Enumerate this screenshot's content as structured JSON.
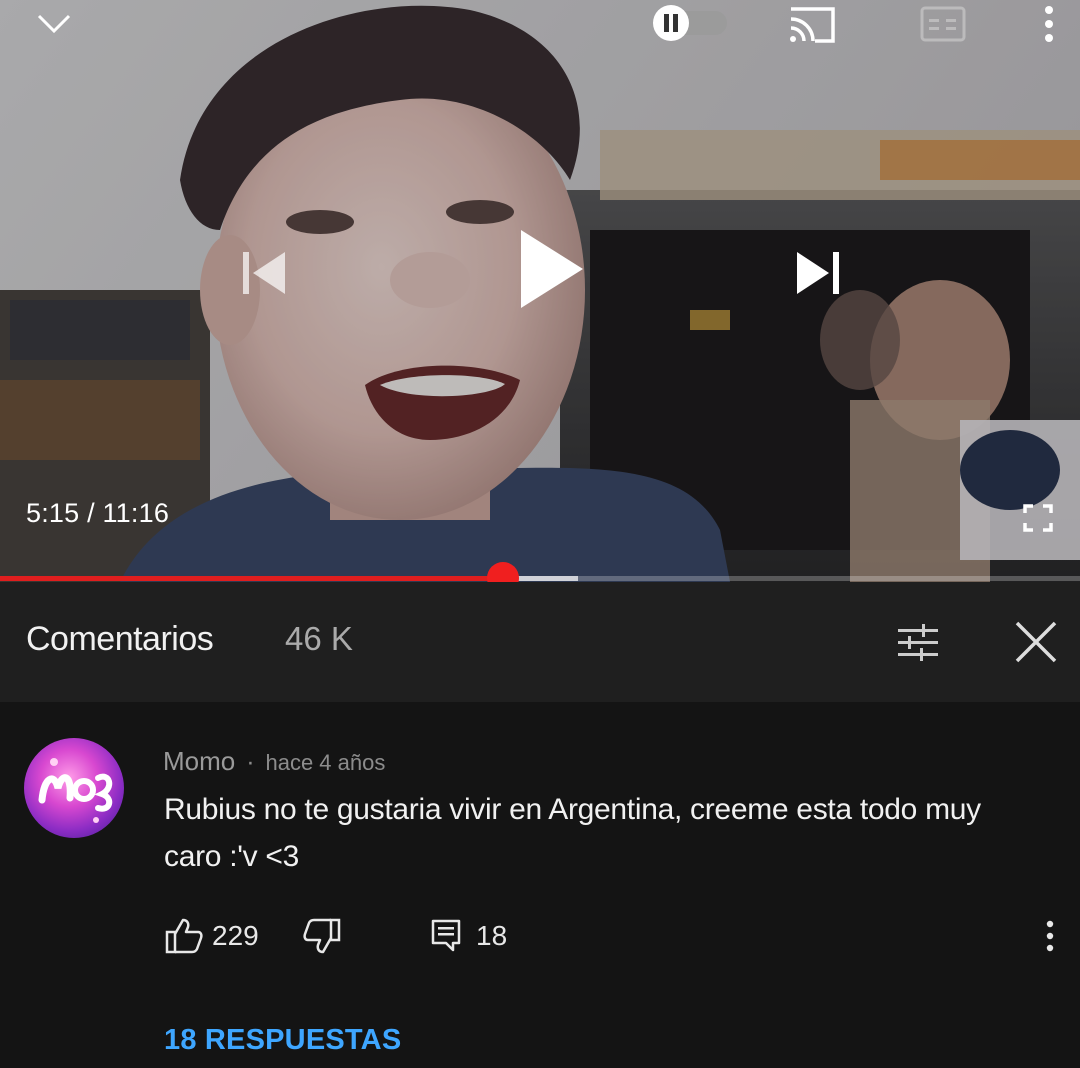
{
  "player": {
    "current_time": "5:15",
    "separator": "/",
    "duration": "11:16",
    "progress_fraction": 0.466,
    "buffer_fraction": 0.535,
    "accent_color": "#e01e1e"
  },
  "comments": {
    "title": "Comentarios",
    "count": "46 K"
  },
  "comment": {
    "author": "Momo",
    "separator": "·",
    "age": "hace 4 años",
    "text": "Rubius no te gustaria vivir en Argentina, creeme esta todo muy caro :'v <3",
    "likes": "229",
    "reply_count": "18",
    "replies_link": "18 RESPUESTAS"
  },
  "icons": {
    "collapse": "chevron-down-icon",
    "autoplay": "autoplay-toggle-icon",
    "cast": "cast-icon",
    "captions": "captions-icon",
    "more": "more-vert-icon",
    "previous": "skip-previous-icon",
    "play": "play-icon",
    "next": "skip-next-icon",
    "fullscreen": "fullscreen-icon",
    "filter": "sort-filter-icon",
    "close": "close-icon",
    "like": "thumb-up-icon",
    "dislike": "thumb-down-icon",
    "reply": "comment-icon"
  }
}
